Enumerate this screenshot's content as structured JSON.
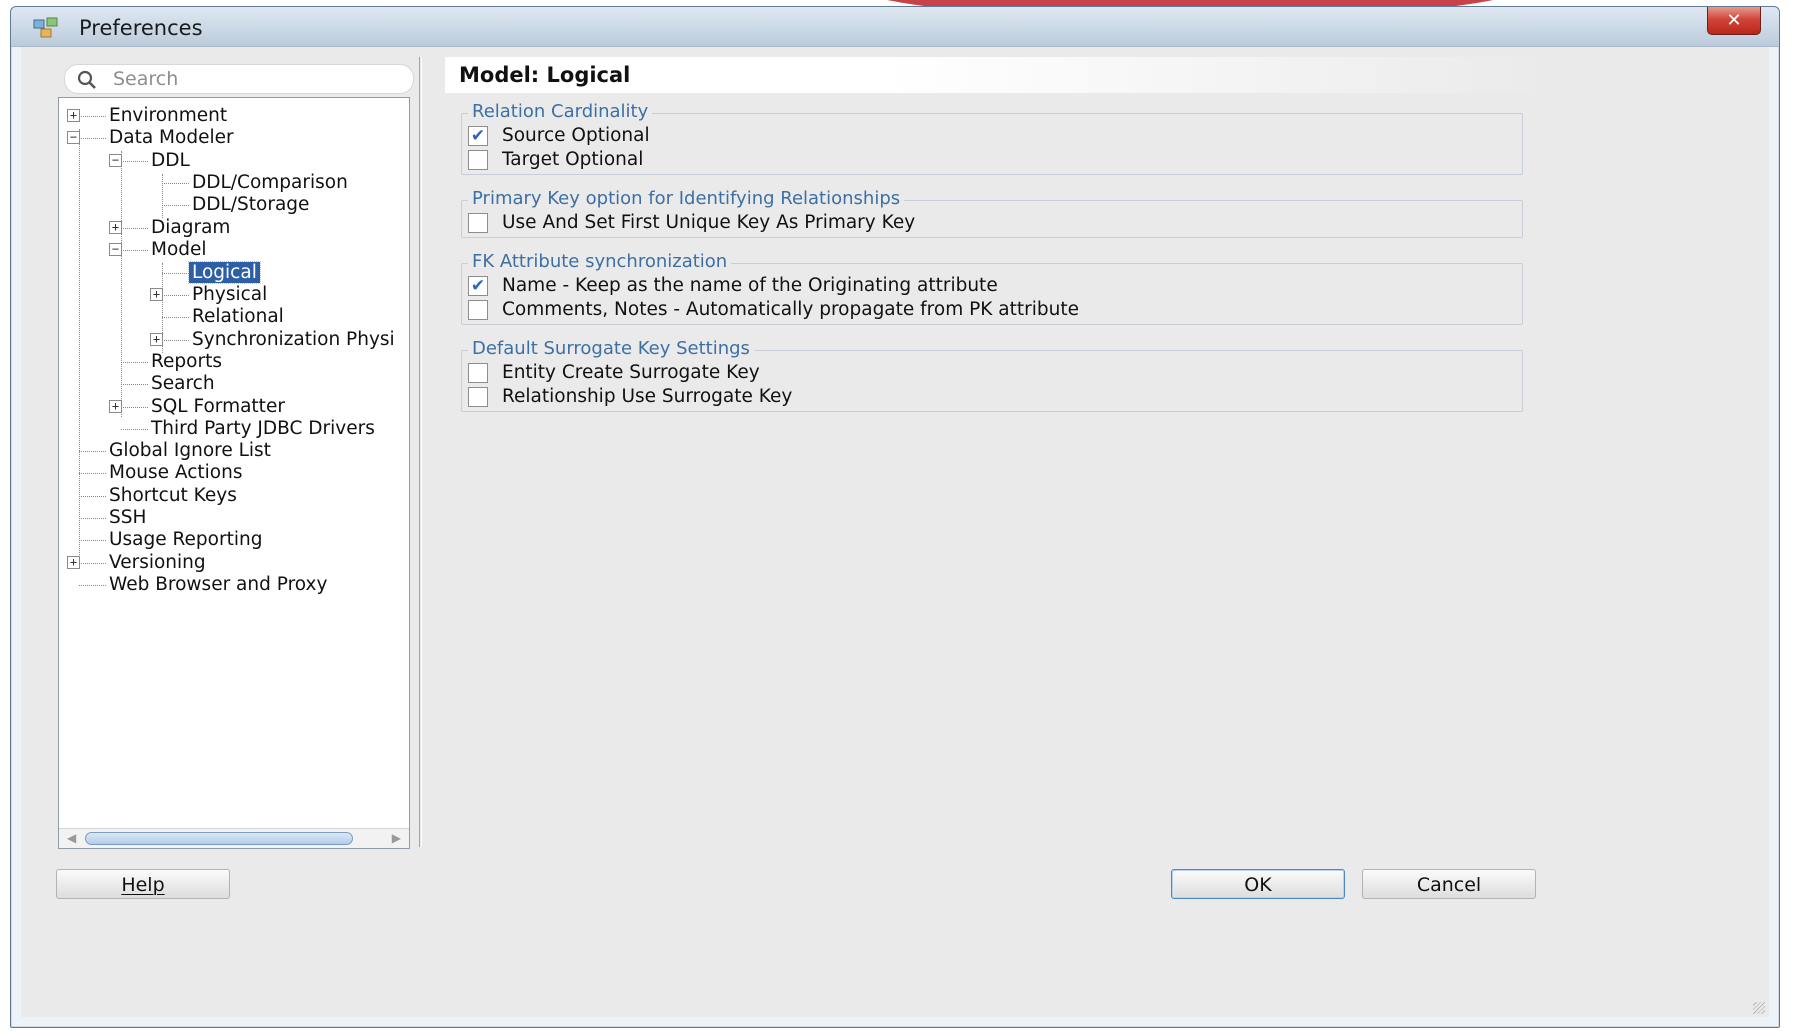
{
  "window": {
    "title": "Preferences",
    "close_label": "✕"
  },
  "search": {
    "placeholder": "Search"
  },
  "tree": {
    "items": [
      {
        "label": "Environment",
        "toggle": "+"
      },
      {
        "label": "Data Modeler",
        "toggle": "−"
      },
      {
        "label": "DDL",
        "toggle": "−"
      },
      {
        "label": "DDL/Comparison"
      },
      {
        "label": "DDL/Storage"
      },
      {
        "label": "Diagram",
        "toggle": "+"
      },
      {
        "label": "Model",
        "toggle": "−"
      },
      {
        "label": "Logical",
        "selected": true
      },
      {
        "label": "Physical",
        "toggle": "+"
      },
      {
        "label": "Relational"
      },
      {
        "label": "Synchronization Physi",
        "toggle": "+"
      },
      {
        "label": "Reports"
      },
      {
        "label": "Search"
      },
      {
        "label": "SQL Formatter",
        "toggle": "+"
      },
      {
        "label": "Third Party JDBC Drivers"
      },
      {
        "label": "Global Ignore List"
      },
      {
        "label": "Mouse Actions"
      },
      {
        "label": "Shortcut Keys"
      },
      {
        "label": "SSH"
      },
      {
        "label": "Usage Reporting"
      },
      {
        "label": "Versioning",
        "toggle": "+"
      },
      {
        "label": "Web Browser and Proxy"
      }
    ]
  },
  "panel": {
    "title": "Model: Logical",
    "groups": [
      {
        "legend": "Relation Cardinality",
        "options": [
          {
            "label": "Source Optional",
            "checked": true
          },
          {
            "label": "Target Optional",
            "checked": false
          }
        ]
      },
      {
        "legend": "Primary Key option for Identifying Relationships",
        "options": [
          {
            "label": "Use And Set First Unique Key As Primary Key",
            "checked": false
          }
        ]
      },
      {
        "legend": "FK Attribute synchronization",
        "options": [
          {
            "label": "Name - Keep as the name of the Originating attribute",
            "checked": true
          },
          {
            "label": "Comments, Notes - Automatically propagate from PK attribute",
            "checked": false
          }
        ]
      },
      {
        "legend": "Default Surrogate Key Settings",
        "options": [
          {
            "label": "Entity Create Surrogate Key",
            "checked": false
          },
          {
            "label": "Relationship Use Surrogate Key",
            "checked": false
          }
        ]
      }
    ]
  },
  "buttons": {
    "help": "Help",
    "ok": "OK",
    "cancel": "Cancel"
  },
  "colors": {
    "selection": "#2d5fa6",
    "legend_text": "#3d6fa5",
    "check_mark": "#2a66c4"
  }
}
